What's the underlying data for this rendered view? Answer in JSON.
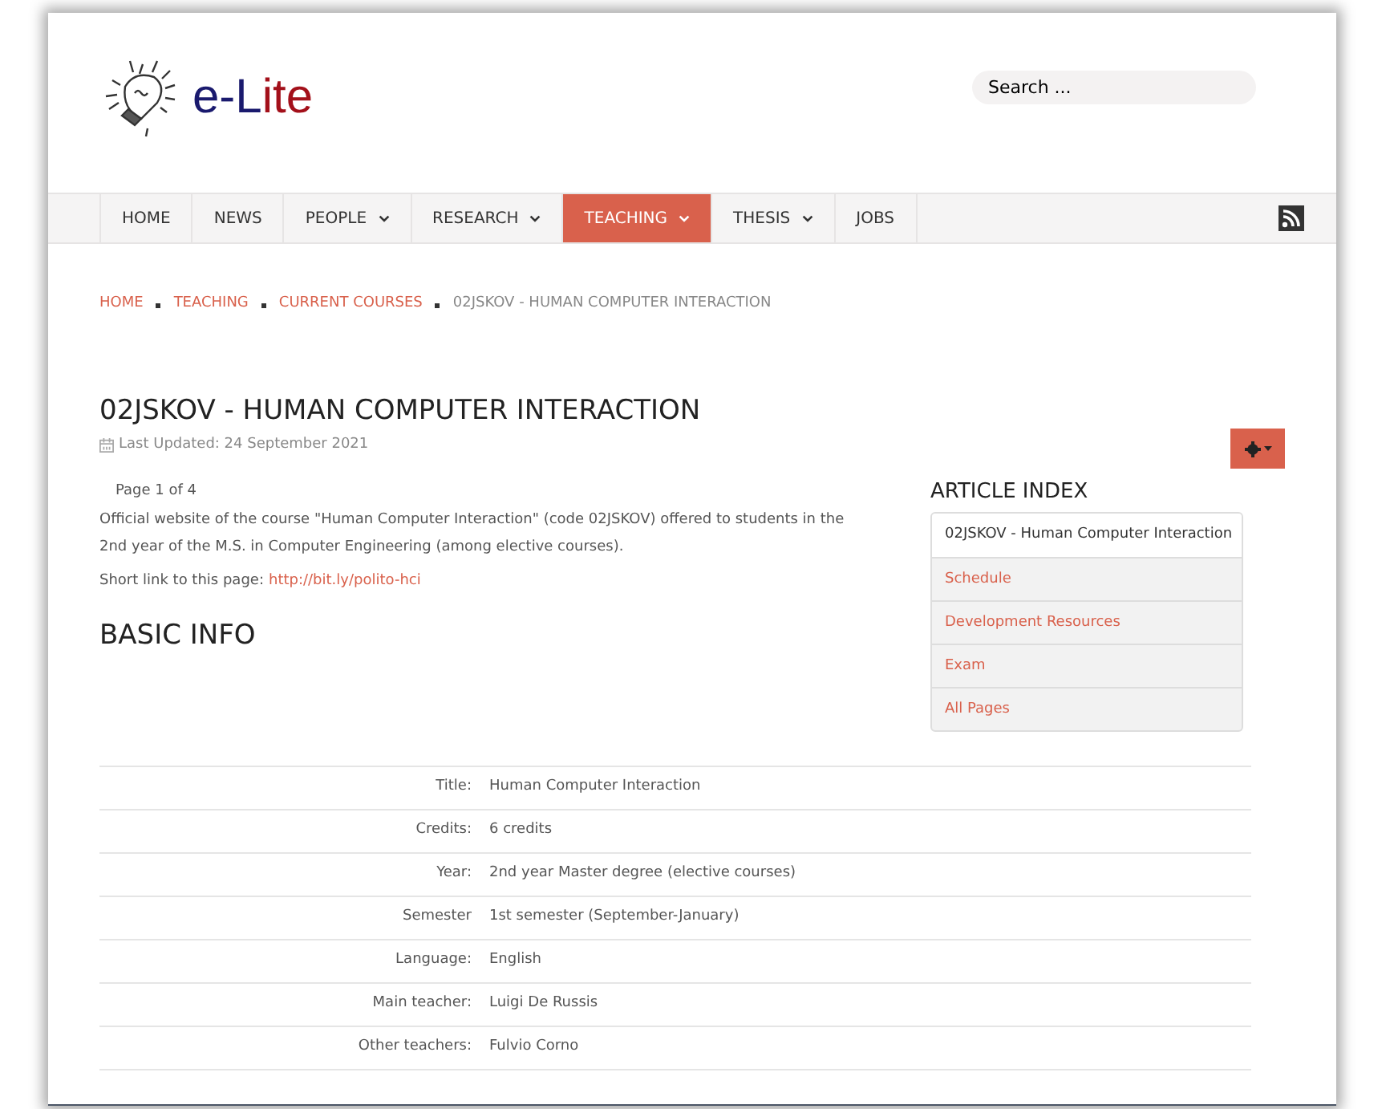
{
  "logo": {
    "dark_part": "e-L",
    "accent_part": "ite"
  },
  "search": {
    "placeholder": "Search ..."
  },
  "nav": [
    {
      "label": "HOME",
      "dropdown": false,
      "selected": false
    },
    {
      "label": "NEWS",
      "dropdown": false,
      "selected": false
    },
    {
      "label": "PEOPLE",
      "dropdown": true,
      "selected": false
    },
    {
      "label": "RESEARCH",
      "dropdown": true,
      "selected": false
    },
    {
      "label": "TEACHING",
      "dropdown": true,
      "selected": true
    },
    {
      "label": "THESIS",
      "dropdown": true,
      "selected": false
    },
    {
      "label": "JOBS",
      "dropdown": false,
      "selected": false
    }
  ],
  "breadcrumb": [
    {
      "label": "HOME",
      "link": true
    },
    {
      "label": "TEACHING",
      "link": true
    },
    {
      "label": "CURRENT COURSES",
      "link": true
    },
    {
      "label": "02JSKOV - HUMAN COMPUTER INTERACTION",
      "link": false
    }
  ],
  "article": {
    "title": "02JSKOV - HUMAN COMPUTER INTERACTION",
    "last_updated": "Last Updated: 24 September 2021",
    "page_indicator": "Page 1 of 4",
    "intro": "Official website of the course \"Human Computer Interaction\" (code 02JSKOV) offered to students in the 2nd year of the M.S. in Computer Engineering (among elective courses).",
    "short_link_label": "Short link to this page:",
    "short_link": "http://bit.ly/polito-hci",
    "section_heading": "BASIC INFO"
  },
  "article_index": {
    "heading": "ARTICLE INDEX",
    "items": [
      {
        "label": "02JSKOV - Human Computer Interaction",
        "selected": true
      },
      {
        "label": "Schedule",
        "selected": false
      },
      {
        "label": "Development Resources",
        "selected": false
      },
      {
        "label": "Exam",
        "selected": false
      },
      {
        "label": "All Pages",
        "selected": false
      }
    ]
  },
  "info_table": [
    {
      "label": "Title:",
      "value": "Human Computer Interaction"
    },
    {
      "label": "Credits:",
      "value": "6 credits"
    },
    {
      "label": "Year:",
      "value": "2nd year Master degree (elective courses)"
    },
    {
      "label": "Semester",
      "value": "1st semester (September-January)"
    },
    {
      "label": "Language:",
      "value": "English"
    },
    {
      "label": "Main teacher:",
      "value": "Luigi De Russis"
    },
    {
      "label": "Other teachers:",
      "value": "Fulvio Corno"
    }
  ]
}
